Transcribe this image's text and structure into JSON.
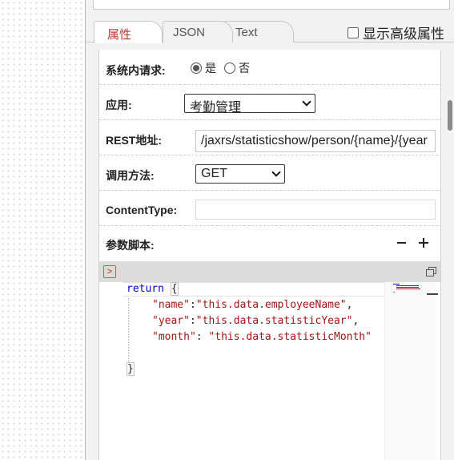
{
  "tabs": [
    {
      "label": "属性",
      "active": true
    },
    {
      "label": "JSON",
      "active": false
    },
    {
      "label": "Text",
      "active": false
    }
  ],
  "advanced_checkbox": {
    "label": "显示高级属性",
    "checked": false
  },
  "form": {
    "internal_request": {
      "label": "系统内请求:",
      "options": [
        "是",
        "否"
      ],
      "selected": "是"
    },
    "application": {
      "label": "应用:",
      "value": "考勤管理"
    },
    "rest_address": {
      "label": "REST地址:",
      "value": "/jaxrs/statisticshow/person/{name}/{year"
    },
    "method": {
      "label": "调用方法:",
      "value": "GET"
    },
    "content_type": {
      "label": "ContentType:",
      "value": ""
    },
    "param_script": {
      "label": "参数脚本:"
    }
  },
  "editor": {
    "keyword": "return",
    "open_brace": "{",
    "close_brace": "}",
    "props": [
      {
        "key": "\"name\"",
        "sep": ":",
        "value": "\"this.data.employeeName\"",
        "end": ","
      },
      {
        "key": "\"year\"",
        "sep": ":",
        "value": "\"this.data.statisticYear\"",
        "end": ","
      },
      {
        "key": "\"month\"",
        "sep": ": ",
        "value": "\"this.data.statisticMonth\"",
        "end": ""
      }
    ]
  },
  "colors": {
    "active_tab": "#c0392b",
    "keyword": "#0000cc",
    "string": "#a31515",
    "editor_bar": "#dcdcdc"
  },
  "icons": [
    "run-script-icon",
    "maximize-editor-icon",
    "remove-icon",
    "add-icon",
    "chevron-down-icon"
  ]
}
